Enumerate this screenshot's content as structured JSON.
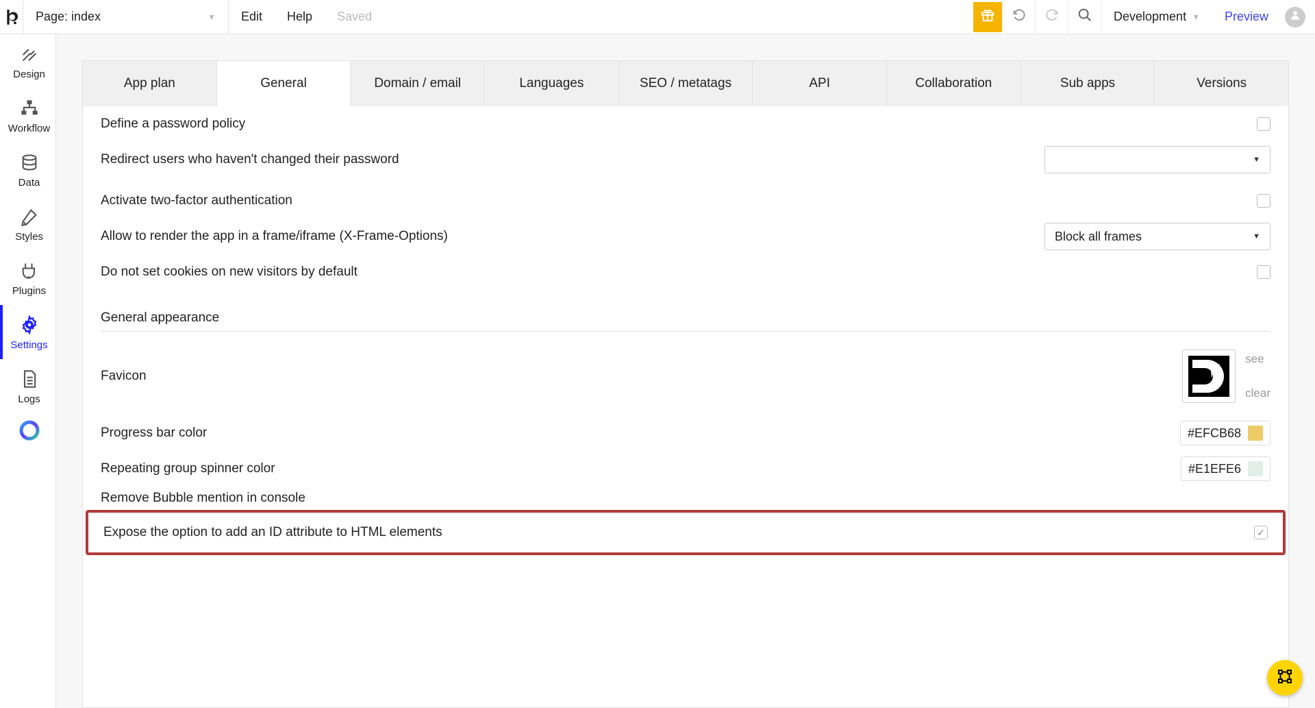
{
  "topbar": {
    "page_label": "Page: index",
    "edit": "Edit",
    "help": "Help",
    "saved": "Saved",
    "env": "Development",
    "preview": "Preview"
  },
  "sidebar": {
    "items": [
      {
        "key": "design",
        "label": "Design"
      },
      {
        "key": "workflow",
        "label": "Workflow"
      },
      {
        "key": "data",
        "label": "Data"
      },
      {
        "key": "styles",
        "label": "Styles"
      },
      {
        "key": "plugins",
        "label": "Plugins"
      },
      {
        "key": "settings",
        "label": "Settings"
      },
      {
        "key": "logs",
        "label": "Logs"
      }
    ]
  },
  "tabs": [
    "App plan",
    "General",
    "Domain / email",
    "Languages",
    "SEO / metatags",
    "API",
    "Collaboration",
    "Sub apps",
    "Versions"
  ],
  "settings": {
    "password_policy": "Define a password policy",
    "redirect_users": "Redirect users who haven't changed their password",
    "two_factor": "Activate two-factor authentication",
    "iframe": "Allow to render the app in a frame/iframe (X-Frame-Options)",
    "iframe_value": "Block all frames",
    "no_cookies": "Do not set cookies on new visitors by default",
    "appearance_header": "General appearance",
    "favicon": "Favicon",
    "see": "see",
    "clear": "clear",
    "progress_bar": "Progress bar color",
    "progress_bar_color": "#EFCB68",
    "spinner": "Repeating group spinner color",
    "spinner_color": "#E1EFE6",
    "remove_bubble": "Remove Bubble mention in console",
    "expose_id": "Expose the option to add an ID attribute to HTML elements"
  }
}
